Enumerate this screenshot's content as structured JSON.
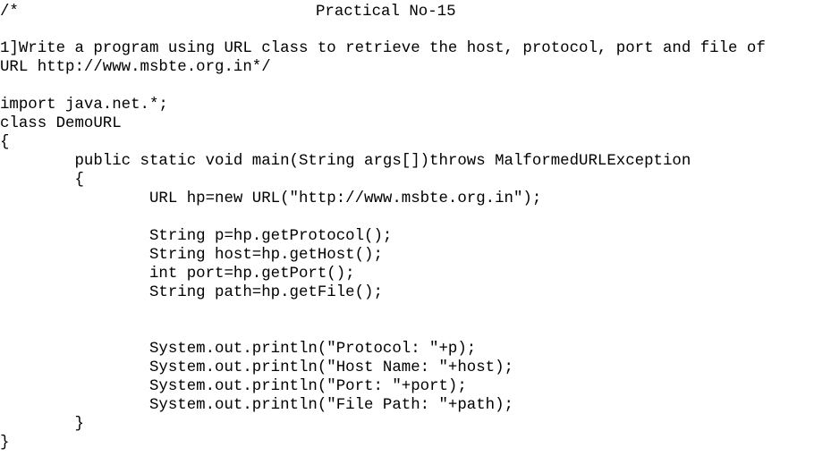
{
  "document": {
    "comment_open": "/*",
    "title": "Practical No-15",
    "question_line1": "1]Write a program using URL class to retrieve the host, protocol, port and file of",
    "question_line2": "URL http://www.msbte.org.in*/",
    "code": [
      "import java.net.*;",
      "class DemoURL",
      "{",
      "        public static void main(String args[])throws MalformedURLException",
      "        {",
      "                URL hp=new URL(\"http://www.msbte.org.in\");",
      "                String p=hp.getProtocol();",
      "                String host=hp.getHost();",
      "                int port=hp.getPort();",
      "                String path=hp.getFile();",
      "                System.out.println(\"Protocol: \"+p);",
      "                System.out.println(\"Host Name: \"+host);",
      "                System.out.println(\"Port: \"+port);",
      "                System.out.println(\"File Path: \"+path);",
      "        }",
      "}"
    ]
  }
}
